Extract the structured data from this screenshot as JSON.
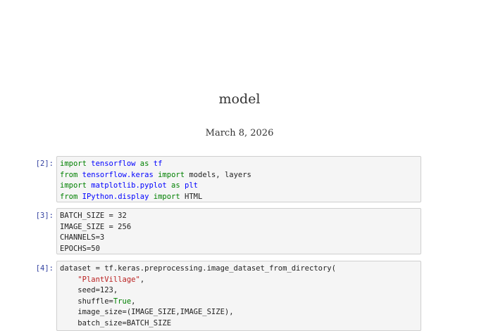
{
  "document": {
    "title": "model",
    "date": "March 8, 2026"
  },
  "cells": [
    {
      "prompt": "[2]:",
      "lines": [
        [
          {
            "t": "import",
            "c": "kw"
          },
          {
            "t": " ",
            "c": ""
          },
          {
            "t": "tensorflow",
            "c": "mod"
          },
          {
            "t": " as ",
            "c": "kw"
          },
          {
            "t": "tf",
            "c": "mod"
          }
        ],
        [
          {
            "t": "from",
            "c": "kw"
          },
          {
            "t": " ",
            "c": ""
          },
          {
            "t": "tensorflow.keras",
            "c": "mod"
          },
          {
            "t": " import",
            "c": "kw"
          },
          {
            "t": " models, layers",
            "c": ""
          }
        ],
        [
          {
            "t": "import",
            "c": "kw"
          },
          {
            "t": " ",
            "c": ""
          },
          {
            "t": "matplotlib.pyplot",
            "c": "mod"
          },
          {
            "t": " as ",
            "c": "kw"
          },
          {
            "t": "plt",
            "c": "mod"
          }
        ],
        [
          {
            "t": "from",
            "c": "kw"
          },
          {
            "t": " ",
            "c": ""
          },
          {
            "t": "IPython.display",
            "c": "mod"
          },
          {
            "t": " import",
            "c": "kw"
          },
          {
            "t": " HTML",
            "c": ""
          }
        ]
      ]
    },
    {
      "prompt": "[3]:",
      "lines": [
        [
          {
            "t": "BATCH_SIZE = 32",
            "c": ""
          }
        ],
        [
          {
            "t": "IMAGE_SIZE = 256",
            "c": ""
          }
        ],
        [
          {
            "t": "CHANNELS=3",
            "c": ""
          }
        ],
        [
          {
            "t": "EPOCHS=50",
            "c": ""
          }
        ]
      ]
    },
    {
      "prompt": "[4]:",
      "lines": [
        [
          {
            "t": "dataset = tf.keras.preprocessing.image_dataset_from_directory(",
            "c": ""
          }
        ],
        [
          {
            "t": "    ",
            "c": ""
          },
          {
            "t": "\"PlantVillage\"",
            "c": "str"
          },
          {
            "t": ",",
            "c": ""
          }
        ],
        [
          {
            "t": "    seed=123,",
            "c": ""
          }
        ],
        [
          {
            "t": "    shuffle=",
            "c": ""
          },
          {
            "t": "True",
            "c": "kw"
          },
          {
            "t": ",",
            "c": ""
          }
        ],
        [
          {
            "t": "    image_size=(IMAGE_SIZE,IMAGE_SIZE),",
            "c": ""
          }
        ],
        [
          {
            "t": "    batch_size=BATCH_SIZE",
            "c": ""
          }
        ]
      ]
    }
  ]
}
